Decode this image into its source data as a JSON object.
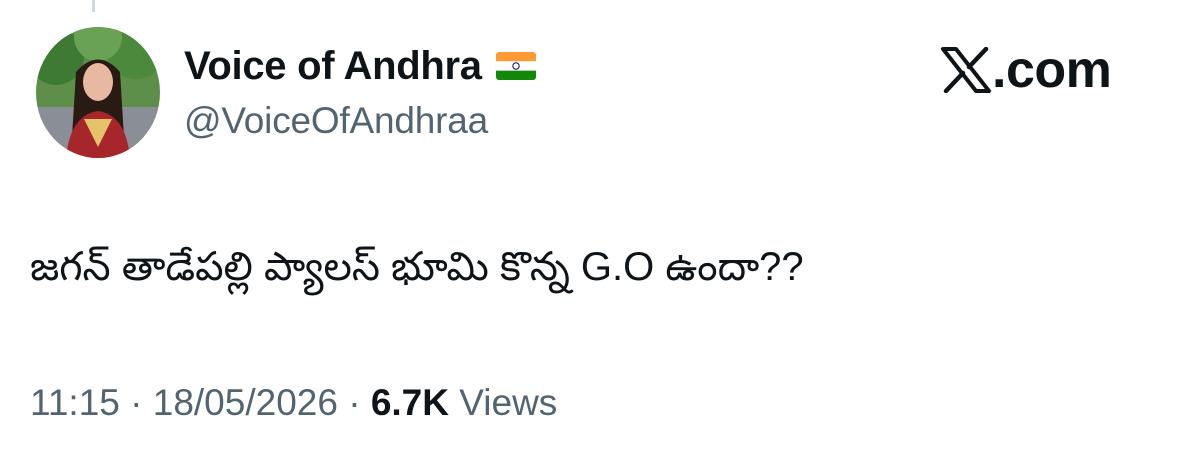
{
  "author": {
    "display_name": "Voice of Andhra",
    "flag_icon": "india-flag-icon",
    "handle": "@VoiceOfAndhraa"
  },
  "brand": {
    "text": ".com",
    "icon": "x-logo-icon"
  },
  "tweet": {
    "text": "జగన్ తాడేపల్లి ప్యాలస్ భూమి కొన్న G.O ఉందా??"
  },
  "meta": {
    "time": "11:15",
    "separator": " · ",
    "date": "18/05/2026",
    "views_count": "6.7K",
    "views_label": " Views"
  },
  "colors": {
    "primary_text": "#0f1419",
    "secondary_text": "#536471",
    "background": "#ffffff"
  }
}
